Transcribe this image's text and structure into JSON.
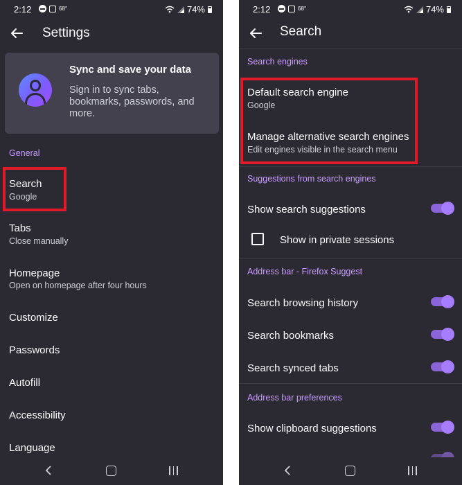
{
  "status_bar": {
    "time": "2:12",
    "temp": "68°",
    "battery": "74%"
  },
  "left": {
    "title": "Settings",
    "sync": {
      "title": "Sync and save your data",
      "line1": "Sign in to sync tabs,",
      "line2": "bookmarks, passwords, and",
      "line3": "more."
    },
    "section_general": "General",
    "items": [
      {
        "title": "Search",
        "subtitle": "Google"
      },
      {
        "title": "Tabs",
        "subtitle": "Close manually"
      },
      {
        "title": "Homepage",
        "subtitle": "Open on homepage after four hours"
      },
      {
        "title": "Customize"
      },
      {
        "title": "Passwords"
      },
      {
        "title": "Autofill"
      },
      {
        "title": "Accessibility"
      },
      {
        "title": "Language"
      }
    ]
  },
  "right": {
    "title": "Search",
    "section_engines": "Search engines",
    "default_engine": {
      "title": "Default search engine",
      "subtitle": "Google"
    },
    "manage_engines": {
      "title": "Manage alternative search engines",
      "subtitle": "Edit engines visible in the search menu"
    },
    "section_suggestions": "Suggestions from search engines",
    "show_suggestions": {
      "label": "Show search suggestions",
      "on": true
    },
    "private_sessions": {
      "label": "Show in private sessions",
      "checked": false
    },
    "section_address_bar": "Address bar - Firefox Suggest",
    "browsing_history": {
      "label": "Search browsing history",
      "on": true
    },
    "bookmarks": {
      "label": "Search bookmarks",
      "on": true
    },
    "synced_tabs": {
      "label": "Search synced tabs",
      "on": true
    },
    "section_preferences": "Address bar preferences",
    "clipboard": {
      "label": "Show clipboard suggestions",
      "on": true
    }
  },
  "colors": {
    "background": "#2b2a33",
    "card": "#42414d",
    "accent": "#c89dff",
    "toggle": "#a77dff",
    "highlight": "#e11a27"
  },
  "icons": [
    "back-arrow-icon",
    "account-avatar-icon",
    "nav-back-icon",
    "nav-home-icon",
    "nav-recents-icon",
    "wifi-icon",
    "signal-icon",
    "battery-icon",
    "dnd-icon",
    "gallery-icon"
  ]
}
